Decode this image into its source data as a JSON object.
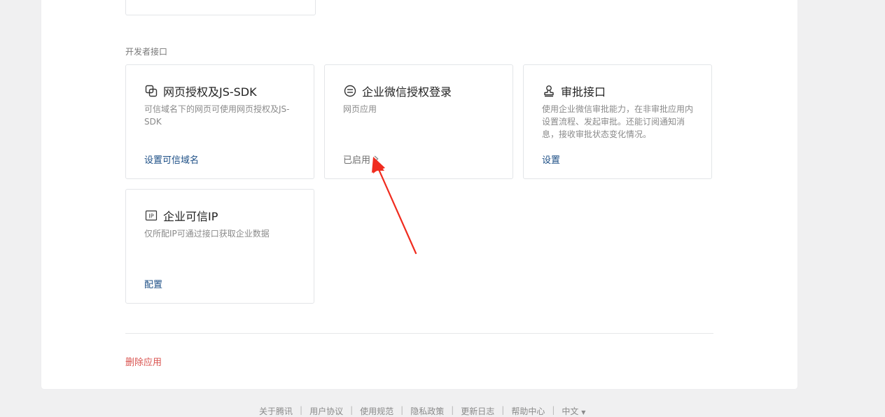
{
  "section": {
    "title": "开发者接口"
  },
  "cards": [
    {
      "title": "网页授权及JS-SDK",
      "desc": "可信域名下的网页可使用网页授权及JS-SDK",
      "action": "设置可信域名",
      "icon": "copy-squares-icon"
    },
    {
      "title": "企业微信授权登录",
      "desc": "网页应用",
      "status": "已启用",
      "icon": "circle-equals-icon"
    },
    {
      "title": "审批接口",
      "desc": "使用企业微信审批能力，在非审批应用内设置流程、发起审批。还能订阅通知消息，接收审批状态变化情况。",
      "action": "设置",
      "icon": "stamp-icon"
    },
    {
      "title": "企业可信IP",
      "desc": "仅所配IP可通过接口获取企业数据",
      "action": "配置",
      "icon": "ip-badge-icon",
      "icon_text": "IP"
    }
  ],
  "delete_label": "删除应用",
  "footer": {
    "links": [
      "关于腾讯",
      "用户协议",
      "使用规范",
      "隐私政策",
      "更新日志",
      "帮助中心",
      "中文"
    ],
    "lang_caret": "▼"
  },
  "colors": {
    "link": "#1d4f86",
    "danger": "#d9534f",
    "annotation_arrow": "#f02c1f"
  }
}
